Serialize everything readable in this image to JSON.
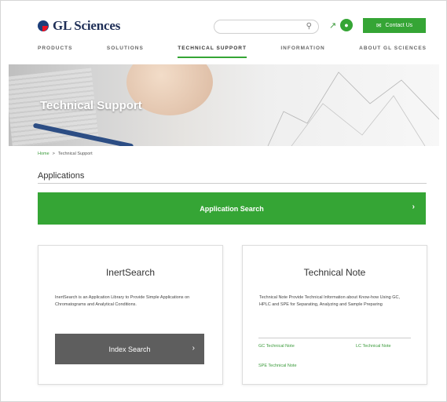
{
  "header": {
    "logo_text": "GL Sciences",
    "contact_label": "Contact Us",
    "colors": {
      "brand_green": "#35a535",
      "logo_navy": "#1f2f57"
    }
  },
  "nav": {
    "items": [
      {
        "label": "PRODUCTS"
      },
      {
        "label": "SOLUTIONS"
      },
      {
        "label": "TECHNICAL SUPPORT"
      },
      {
        "label": "INFORMATION"
      },
      {
        "label": "ABOUT GL SCIENCES"
      }
    ],
    "active_index": 2
  },
  "hero": {
    "title": "Technical Support"
  },
  "breadcrumb": {
    "home": "Home",
    "separator": ">",
    "current": "Technical Support"
  },
  "applications": {
    "heading": "Applications",
    "search_button": "Application Search"
  },
  "inertsearch": {
    "title": "InertSearch",
    "description": "InertSearch is an Application Library to Provide Simple Applications on Chromatograms and Analytical Conditions.",
    "button": "Index Search"
  },
  "technical_note": {
    "title": "Technical Note",
    "description": "Technical Note Provide Technical Information about Know-how Using GC, HPLC and SPE for Separating, Analyzing and Sample Preparing",
    "links": [
      "GC Technical Note",
      "LC Technical Note",
      "SPE Technical Note"
    ]
  },
  "icons": {
    "search": "search-icon",
    "arrow": "arrow-icon",
    "chat": "chat-icon",
    "mail": "mail-icon",
    "chevron": "chevron-right-icon"
  }
}
